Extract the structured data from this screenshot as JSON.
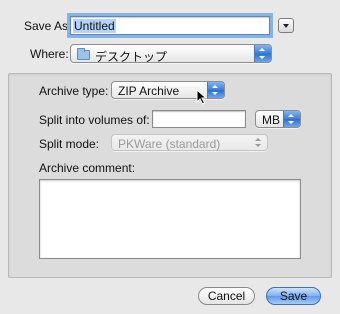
{
  "save_as": {
    "label": "Save As:",
    "value": "Untitled"
  },
  "where": {
    "label": "Where:",
    "value": "デスクトップ",
    "icon": "folder-icon"
  },
  "archive_type": {
    "label": "Archive type:",
    "value": "ZIP Archive"
  },
  "split_volumes": {
    "label": "Split into volumes of:",
    "value": "",
    "unit": "MB"
  },
  "split_mode": {
    "label": "Split mode:",
    "value": "PKWare (standard)"
  },
  "archive_comment": {
    "label": "Archive comment:",
    "value": ""
  },
  "buttons": {
    "cancel": "Cancel",
    "save": "Save"
  }
}
